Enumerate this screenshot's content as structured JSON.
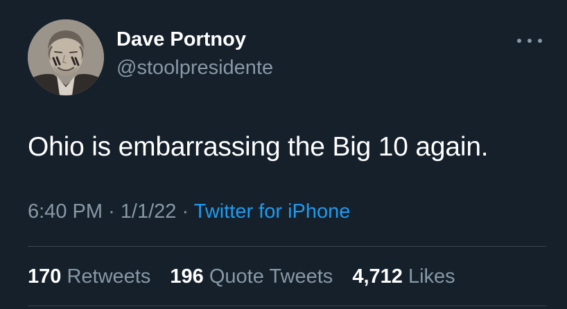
{
  "author": {
    "display_name": "Dave Portnoy",
    "handle": "@stoolpresidente"
  },
  "tweet": {
    "text": "Ohio is embarrassing the Big 10 again.",
    "time": "6:40 PM",
    "separator": "·",
    "date": "1/1/22",
    "source": "Twitter for iPhone"
  },
  "stats": {
    "retweets_count": "170",
    "retweets_label": "Retweets",
    "quotes_count": "196",
    "quotes_label": "Quote Tweets",
    "likes_count": "4,712",
    "likes_label": "Likes"
  },
  "icons": {
    "more": "more-horizontal-icon"
  },
  "colors": {
    "background": "#15202b",
    "primary_text": "#ffffff",
    "secondary_text": "#8899a6",
    "link": "#1d9bf0",
    "divider": "#38444d"
  }
}
